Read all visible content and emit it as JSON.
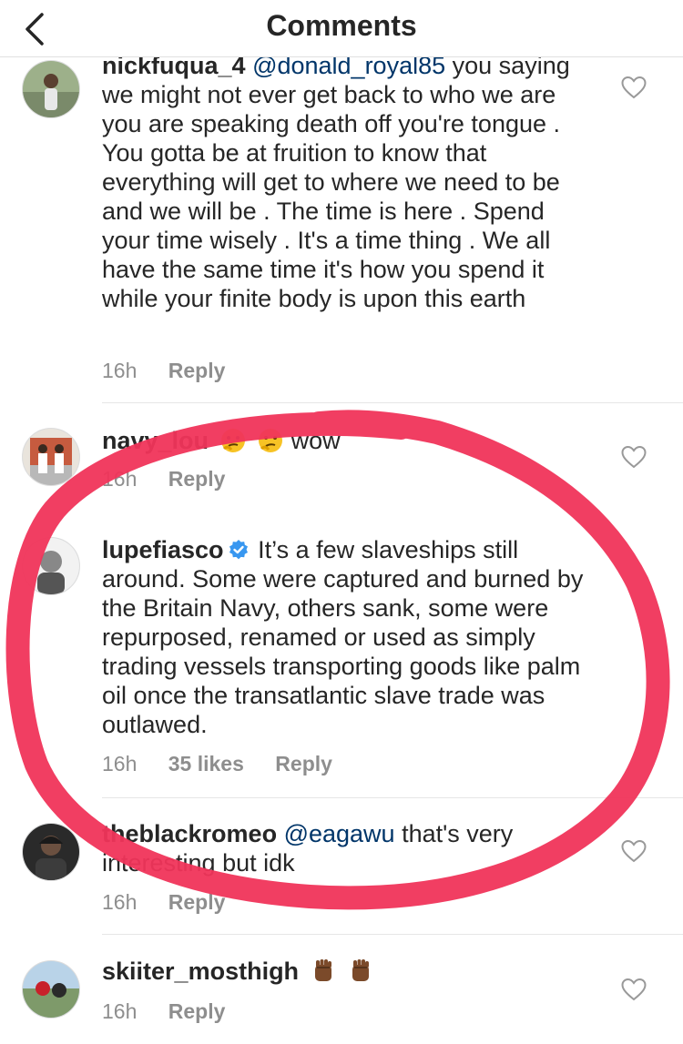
{
  "header": {
    "title": "Comments"
  },
  "comments": [
    {
      "username": "nickfuqua_4",
      "mention": "@donald_royal85",
      "text": "you saying we might not ever get back to who we are you are speaking death off you're tongue . You gotta be at fruition to know that everything will get to where we need to be and we will be . The time is here . Spend your time wisely . It's a time thing . We all have the same time it's how you spend it while your finite body is upon this earth",
      "time": "16h",
      "reply": "Reply"
    },
    {
      "username": "navy_lou",
      "text": "wow",
      "emojis": [
        "thinking-face",
        "thinking-face"
      ],
      "time": "16h",
      "reply": "Reply"
    },
    {
      "username": "lupefiasco",
      "verified": true,
      "text": "It’s a few slaveships still around. Some were captured and burned by the Britain Navy, others sank, some were repurposed, renamed or used as simply trading vessels transporting goods like palm oil once the transatlantic slave trade was outlawed.",
      "time": "16h",
      "likes": "35 likes",
      "reply": "Reply"
    },
    {
      "username": "theblackromeo",
      "mention": "@eagawu",
      "text": "that's very interesting but idk",
      "time": "16h",
      "reply": "Reply"
    },
    {
      "username": "skiiter_mosthigh",
      "emojis": [
        "raised-fist",
        "raised-fist"
      ],
      "time": "16h",
      "reply": "Reply"
    }
  ],
  "colors": {
    "annotation": "#f0345a",
    "mention": "#003569",
    "meta": "#8e8e8e",
    "verified": "#3897f0"
  }
}
